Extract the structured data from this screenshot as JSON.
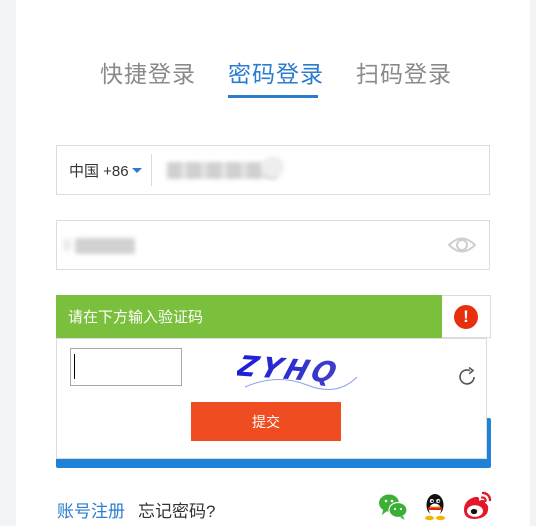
{
  "tabs": [
    {
      "label": "快捷登录",
      "active": false
    },
    {
      "label": "密码登录",
      "active": true
    },
    {
      "label": "扫码登录",
      "active": false
    }
  ],
  "phone": {
    "country_code": "中国 +86",
    "value": ""
  },
  "password": {
    "value": ""
  },
  "captcha": {
    "prompt": "请在下方输入验证码",
    "image_text": "ZYHQ",
    "code_value": "",
    "submit_label": "提交"
  },
  "footer": {
    "register_label": "账号注册",
    "forgot_label": "忘记密码?"
  },
  "colors": {
    "accent": "#2b7ccf",
    "captcha_bar": "#7ac03c",
    "submit": "#f04c22",
    "warning": "#e8300e"
  },
  "icons": [
    "eye-icon",
    "warning-icon",
    "refresh-icon",
    "wechat-icon",
    "qq-icon",
    "weibo-icon"
  ]
}
